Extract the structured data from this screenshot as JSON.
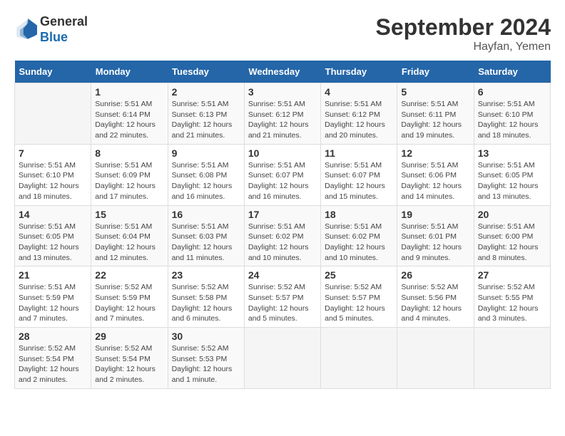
{
  "header": {
    "logo_general": "General",
    "logo_blue": "Blue",
    "month_title": "September 2024",
    "location": "Hayfan, Yemen"
  },
  "weekdays": [
    "Sunday",
    "Monday",
    "Tuesday",
    "Wednesday",
    "Thursday",
    "Friday",
    "Saturday"
  ],
  "days": [
    {
      "num": "",
      "info": ""
    },
    {
      "num": "1",
      "info": "Sunrise: 5:51 AM\nSunset: 6:14 PM\nDaylight: 12 hours\nand 22 minutes."
    },
    {
      "num": "2",
      "info": "Sunrise: 5:51 AM\nSunset: 6:13 PM\nDaylight: 12 hours\nand 21 minutes."
    },
    {
      "num": "3",
      "info": "Sunrise: 5:51 AM\nSunset: 6:12 PM\nDaylight: 12 hours\nand 21 minutes."
    },
    {
      "num": "4",
      "info": "Sunrise: 5:51 AM\nSunset: 6:12 PM\nDaylight: 12 hours\nand 20 minutes."
    },
    {
      "num": "5",
      "info": "Sunrise: 5:51 AM\nSunset: 6:11 PM\nDaylight: 12 hours\nand 19 minutes."
    },
    {
      "num": "6",
      "info": "Sunrise: 5:51 AM\nSunset: 6:10 PM\nDaylight: 12 hours\nand 18 minutes."
    },
    {
      "num": "7",
      "info": "Sunrise: 5:51 AM\nSunset: 6:10 PM\nDaylight: 12 hours\nand 18 minutes."
    },
    {
      "num": "8",
      "info": "Sunrise: 5:51 AM\nSunset: 6:09 PM\nDaylight: 12 hours\nand 17 minutes."
    },
    {
      "num": "9",
      "info": "Sunrise: 5:51 AM\nSunset: 6:08 PM\nDaylight: 12 hours\nand 16 minutes."
    },
    {
      "num": "10",
      "info": "Sunrise: 5:51 AM\nSunset: 6:07 PM\nDaylight: 12 hours\nand 16 minutes."
    },
    {
      "num": "11",
      "info": "Sunrise: 5:51 AM\nSunset: 6:07 PM\nDaylight: 12 hours\nand 15 minutes."
    },
    {
      "num": "12",
      "info": "Sunrise: 5:51 AM\nSunset: 6:06 PM\nDaylight: 12 hours\nand 14 minutes."
    },
    {
      "num": "13",
      "info": "Sunrise: 5:51 AM\nSunset: 6:05 PM\nDaylight: 12 hours\nand 13 minutes."
    },
    {
      "num": "14",
      "info": "Sunrise: 5:51 AM\nSunset: 6:05 PM\nDaylight: 12 hours\nand 13 minutes."
    },
    {
      "num": "15",
      "info": "Sunrise: 5:51 AM\nSunset: 6:04 PM\nDaylight: 12 hours\nand 12 minutes."
    },
    {
      "num": "16",
      "info": "Sunrise: 5:51 AM\nSunset: 6:03 PM\nDaylight: 12 hours\nand 11 minutes."
    },
    {
      "num": "17",
      "info": "Sunrise: 5:51 AM\nSunset: 6:02 PM\nDaylight: 12 hours\nand 10 minutes."
    },
    {
      "num": "18",
      "info": "Sunrise: 5:51 AM\nSunset: 6:02 PM\nDaylight: 12 hours\nand 10 minutes."
    },
    {
      "num": "19",
      "info": "Sunrise: 5:51 AM\nSunset: 6:01 PM\nDaylight: 12 hours\nand 9 minutes."
    },
    {
      "num": "20",
      "info": "Sunrise: 5:51 AM\nSunset: 6:00 PM\nDaylight: 12 hours\nand 8 minutes."
    },
    {
      "num": "21",
      "info": "Sunrise: 5:51 AM\nSunset: 5:59 PM\nDaylight: 12 hours\nand 7 minutes."
    },
    {
      "num": "22",
      "info": "Sunrise: 5:52 AM\nSunset: 5:59 PM\nDaylight: 12 hours\nand 7 minutes."
    },
    {
      "num": "23",
      "info": "Sunrise: 5:52 AM\nSunset: 5:58 PM\nDaylight: 12 hours\nand 6 minutes."
    },
    {
      "num": "24",
      "info": "Sunrise: 5:52 AM\nSunset: 5:57 PM\nDaylight: 12 hours\nand 5 minutes."
    },
    {
      "num": "25",
      "info": "Sunrise: 5:52 AM\nSunset: 5:57 PM\nDaylight: 12 hours\nand 5 minutes."
    },
    {
      "num": "26",
      "info": "Sunrise: 5:52 AM\nSunset: 5:56 PM\nDaylight: 12 hours\nand 4 minutes."
    },
    {
      "num": "27",
      "info": "Sunrise: 5:52 AM\nSunset: 5:55 PM\nDaylight: 12 hours\nand 3 minutes."
    },
    {
      "num": "28",
      "info": "Sunrise: 5:52 AM\nSunset: 5:54 PM\nDaylight: 12 hours\nand 2 minutes."
    },
    {
      "num": "29",
      "info": "Sunrise: 5:52 AM\nSunset: 5:54 PM\nDaylight: 12 hours\nand 2 minutes."
    },
    {
      "num": "30",
      "info": "Sunrise: 5:52 AM\nSunset: 5:53 PM\nDaylight: 12 hours\nand 1 minute."
    },
    {
      "num": "",
      "info": ""
    },
    {
      "num": "",
      "info": ""
    },
    {
      "num": "",
      "info": ""
    },
    {
      "num": "",
      "info": ""
    },
    {
      "num": "",
      "info": ""
    }
  ]
}
